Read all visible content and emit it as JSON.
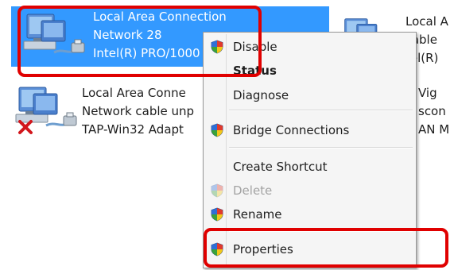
{
  "connections": [
    {
      "name": "Local Area Connection",
      "status": "Network  28",
      "device": "Intel(R) PRO/1000",
      "selected": true
    },
    {
      "name": "Local Area Conne",
      "status": "Network cable unp",
      "device": "TAP-Win32 Adapt",
      "selected": false
    }
  ],
  "partial_right": {
    "top": [
      "Local A",
      "sable",
      "tel(R)"
    ],
    "bottom": [
      "Vig",
      "scon",
      "AN M"
    ]
  },
  "context_menu": {
    "items": [
      {
        "label": "Disable",
        "icon": "uac-shield-icon"
      },
      {
        "label": "Status",
        "bold": true
      },
      {
        "label": "Diagnose"
      },
      {
        "label": "Bridge Connections",
        "icon": "uac-shield-icon"
      },
      {
        "label": "Create Shortcut"
      },
      {
        "label": "Delete",
        "icon": "uac-shield-icon",
        "disabled": true
      },
      {
        "label": "Rename",
        "icon": "uac-shield-icon"
      },
      {
        "label": "Properties",
        "icon": "uac-shield-icon"
      }
    ]
  },
  "colors": {
    "selection": "#3399ff",
    "annotation": "#e00000",
    "menu_bg": "#f5f5f5"
  }
}
